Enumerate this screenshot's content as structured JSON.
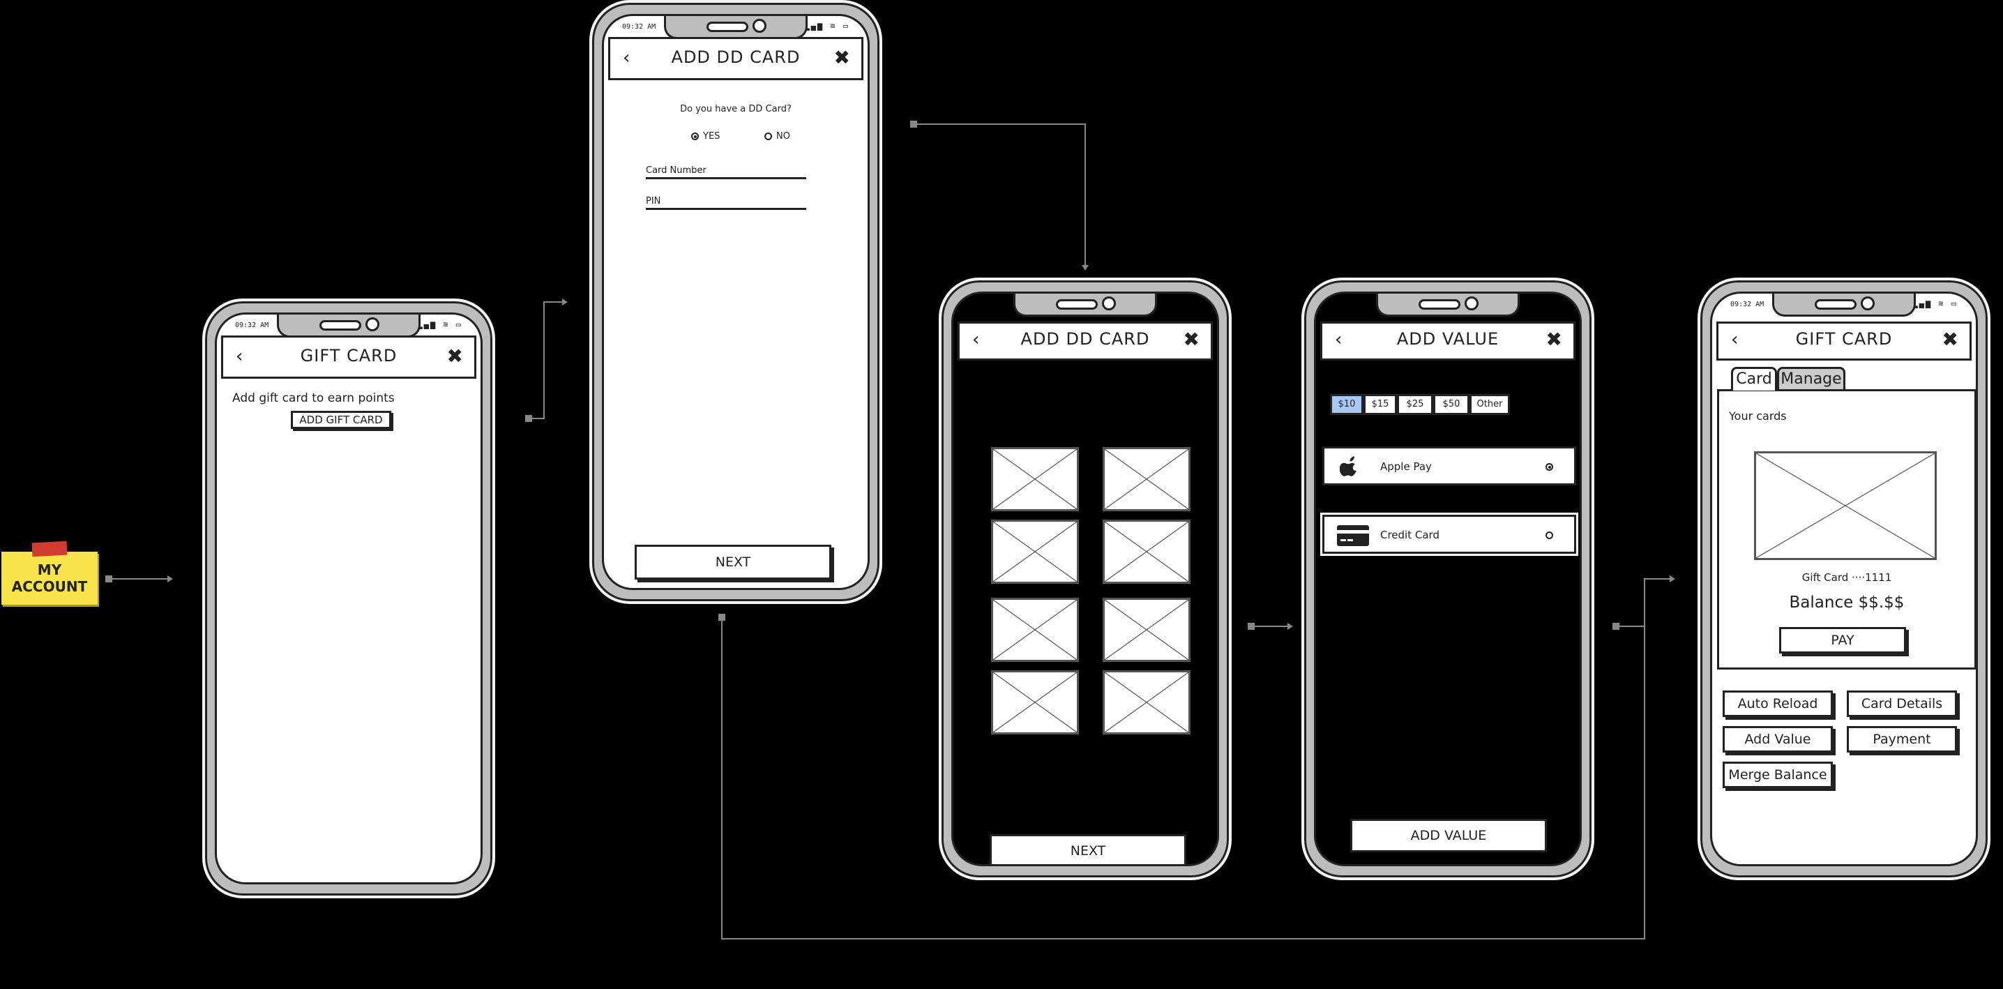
{
  "sticky_note": {
    "label": "MY ACCOUNT"
  },
  "status_time": "09:32 AM",
  "status_icons": "▂▄▆ ≋ ▭",
  "screen1": {
    "title": "GIFT CARD",
    "text": "Add gift card to earn points",
    "button": "ADD GIFT CARD"
  },
  "screen2": {
    "title": "ADD DD CARD",
    "question": "Do you have a DD Card?",
    "option_yes": "YES",
    "option_no": "NO",
    "selected": "YES",
    "card_number_label": "Card Number",
    "pin_label": "PIN",
    "next": "NEXT"
  },
  "screen3": {
    "title": "ADD DD CARD",
    "next": "NEXT"
  },
  "screen4": {
    "title": "ADD VALUE",
    "amounts": [
      "$10",
      "$15",
      "$25",
      "$50",
      "Other"
    ],
    "selected_amount": "$10",
    "apple_pay": "Apple Pay",
    "credit_card": "Credit Card",
    "selected_method": "Apple Pay",
    "add_value": "ADD VALUE"
  },
  "screen5": {
    "title": "GIFT CARD",
    "tab_card": "Card",
    "tab_manage": "Manage",
    "your_cards": "Your cards",
    "card_label": "Gift Card ····1111",
    "balance": "Balance $$.$$",
    "pay": "PAY",
    "auto_reload": "Auto Reload",
    "card_details": "Card Details",
    "add_value": "Add Value",
    "payment": "Payment",
    "merge_balance": "Merge Balance"
  },
  "icons": {
    "back": "‹",
    "close": "✖",
    "apple": "",
    "credit_card": "▬"
  },
  "colors": {
    "background": "#000000",
    "sticky_note": "#f6e34a",
    "tape": "#d23c2e",
    "selected_amount": "#a9c8f4",
    "phone_frame": "#bdbdbd"
  }
}
